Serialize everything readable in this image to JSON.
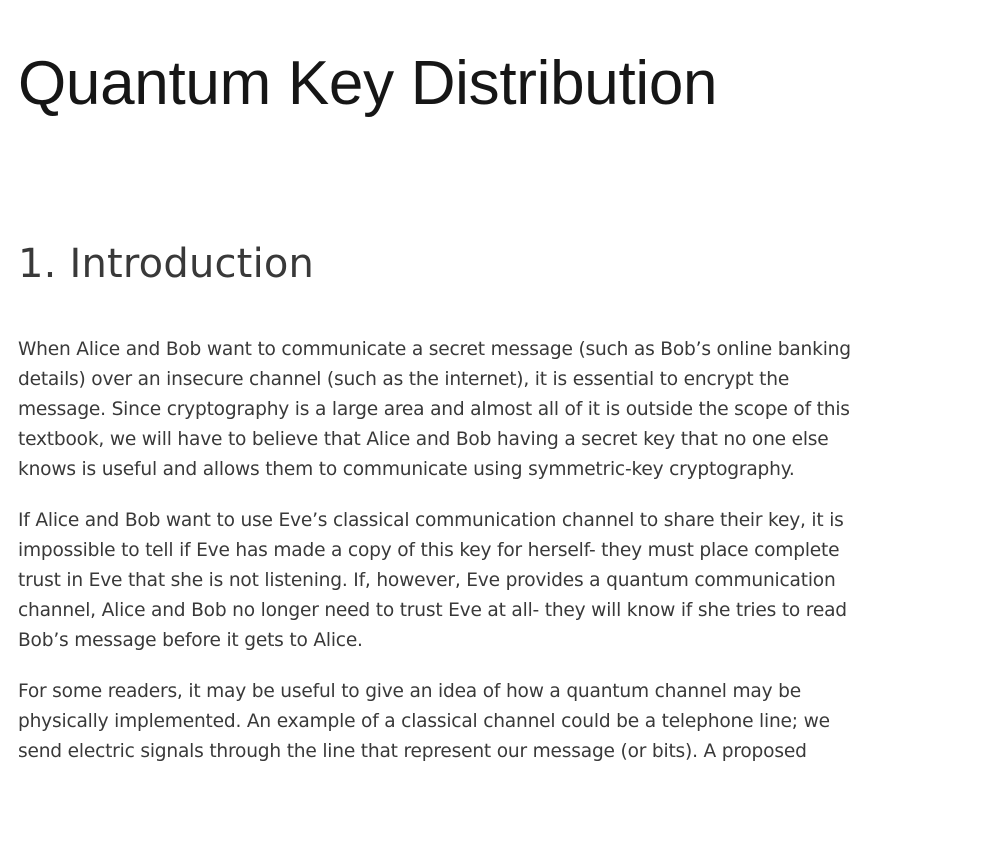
{
  "document": {
    "title": "Quantum Key Distribution",
    "section": {
      "heading": "1. Introduction",
      "paragraphs": [
        "When Alice and Bob want to communicate a secret message (such as Bob’s online banking details) over an insecure channel (such as the internet), it is essential to encrypt the message. Since cryptography is a large area and almost all of it is outside the scope of this textbook, we will have to believe that Alice and Bob having a secret key that no one else knows is useful and allows them to communicate using symmetric-key cryptography.",
        "If Alice and Bob want to use Eve’s classical communication channel to share their key, it is impossible to tell if Eve has made a copy of this key for herself- they must place complete trust in Eve that she is not listening. If, however, Eve provides a quantum communication channel, Alice and Bob no longer need to trust Eve at all- they will know if she tries to read Bob’s message before it gets to Alice.",
        "For some readers, it may be useful to give an idea of how a quantum channel may be physically implemented. An example of a classical channel could be a telephone line; we send electric signals through the line that represent our message (or bits). A proposed"
      ]
    }
  }
}
